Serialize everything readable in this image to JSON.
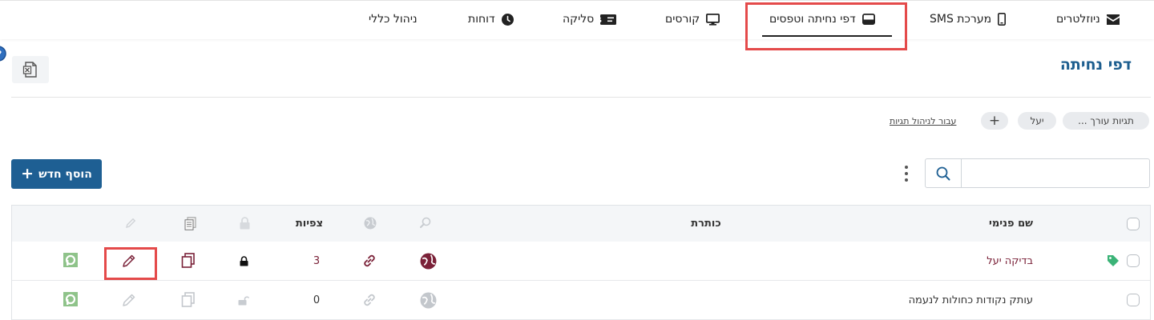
{
  "nav": {
    "items": [
      {
        "key": "newsletters",
        "label": "ניוזלטרים",
        "icon": "envelope-icon"
      },
      {
        "key": "sms",
        "label": "מערכת SMS",
        "icon": "mobile-phone-icon"
      },
      {
        "key": "landing",
        "label": "דפי נחיתה וטפסים",
        "icon": "window-icon",
        "active": true
      },
      {
        "key": "courses",
        "label": "קורסים",
        "icon": "monitor-icon"
      },
      {
        "key": "clearing",
        "label": "סליקה",
        "icon": "money-bill-icon"
      },
      {
        "key": "reports",
        "label": "דוחות",
        "icon": "clock-icon"
      },
      {
        "key": "admin",
        "label": "ניהול כללי",
        "icon": ""
      }
    ]
  },
  "page": {
    "title": "דפי נחיתה"
  },
  "tags": {
    "editor_tags": "תגיות עורך ...",
    "yael": "יעל",
    "add": "+",
    "manage_link": "עבור לניהול תגיות"
  },
  "toolbar": {
    "add_new_label": "הוסף חדש",
    "add_new_plus": "+",
    "search_placeholder": ""
  },
  "table": {
    "headers": {
      "internal_name": "שם פנימי",
      "title": "כותרת",
      "views": "צפיות"
    },
    "rows": [
      {
        "name": "בדיקה יעל",
        "title": "",
        "views": "3",
        "tagged": true,
        "locked": true,
        "active": true
      },
      {
        "name": "עותק נקודות כחולות לנעמה",
        "title": "",
        "views": "0",
        "tagged": false,
        "locked": false,
        "active": false
      }
    ]
  },
  "colors": {
    "brand_blue": "#1e5f93",
    "title_blue": "#1d5e8f",
    "row_accent": "#7a2138",
    "highlight_red": "#e44a4a",
    "tag_green": "#3bb377",
    "badge_green": "#8fc38a"
  }
}
